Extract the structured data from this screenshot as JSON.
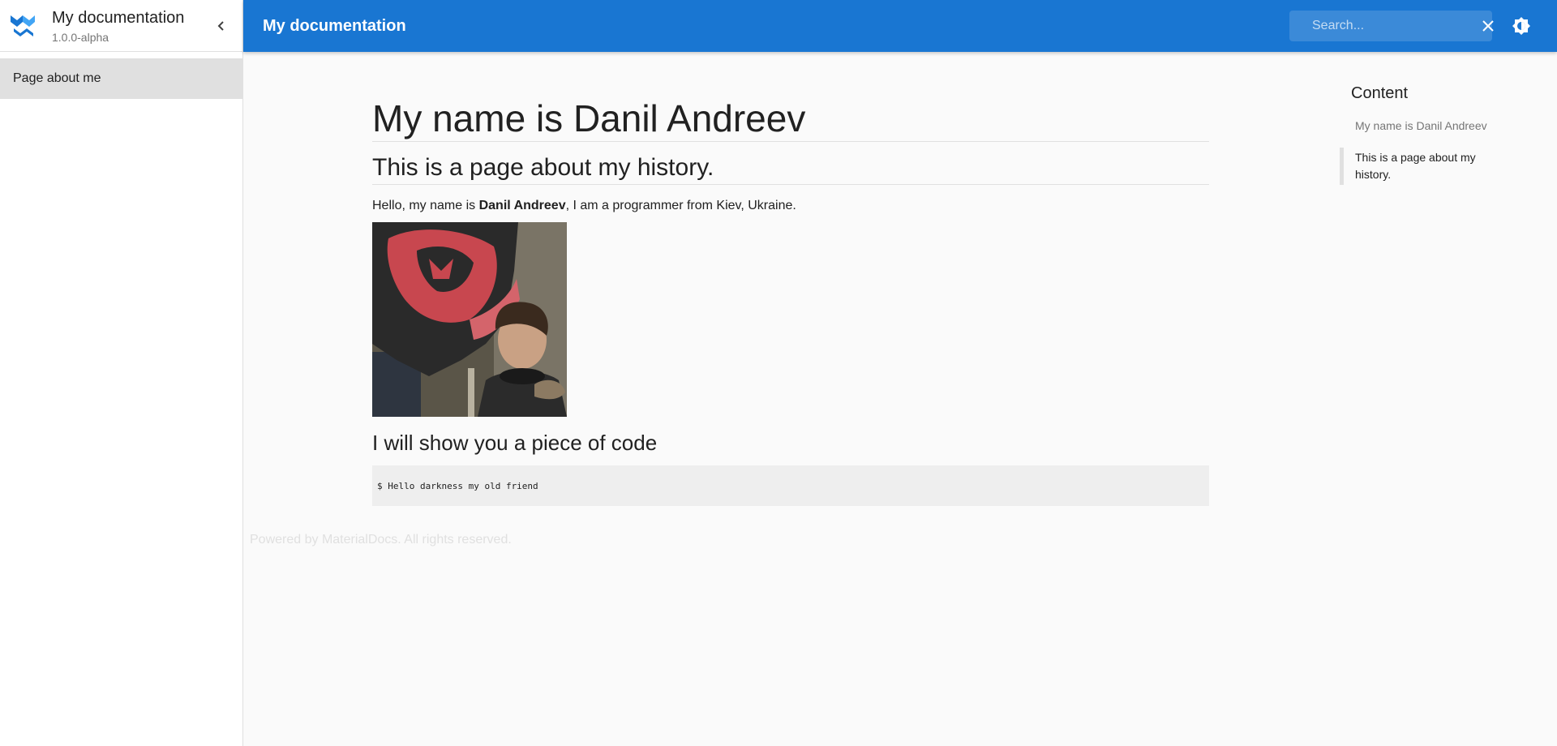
{
  "sidebar": {
    "brand_title": "My documentation",
    "version": "1.0.0-alpha",
    "items": [
      {
        "label": "Page about me"
      }
    ]
  },
  "topbar": {
    "title": "My documentation",
    "search_placeholder": "Search...",
    "color": "#1976d2"
  },
  "content": {
    "h1": "My name is Danil Andreev",
    "h2": "This is a page about my history.",
    "para_prefix": "Hello, my name is ",
    "para_bold": "Danil Andreev",
    "para_suffix": ", I am a programmer from Kiev, Ukraine.",
    "h3": "I will show you a piece of code",
    "code": "$ Hello darkness my old friend"
  },
  "footer": {
    "text": "Powered by MaterialDocs. All rights reserved."
  },
  "toc": {
    "title": "Content",
    "items": [
      {
        "label": "My name is Danil Andreev"
      },
      {
        "label": "This is a page about my history."
      }
    ]
  },
  "icons": {
    "logo": "materialdocs-logo-icon",
    "collapse": "chevron-left-icon",
    "search": "search-icon",
    "clear": "close-icon",
    "theme": "brightness-icon"
  }
}
